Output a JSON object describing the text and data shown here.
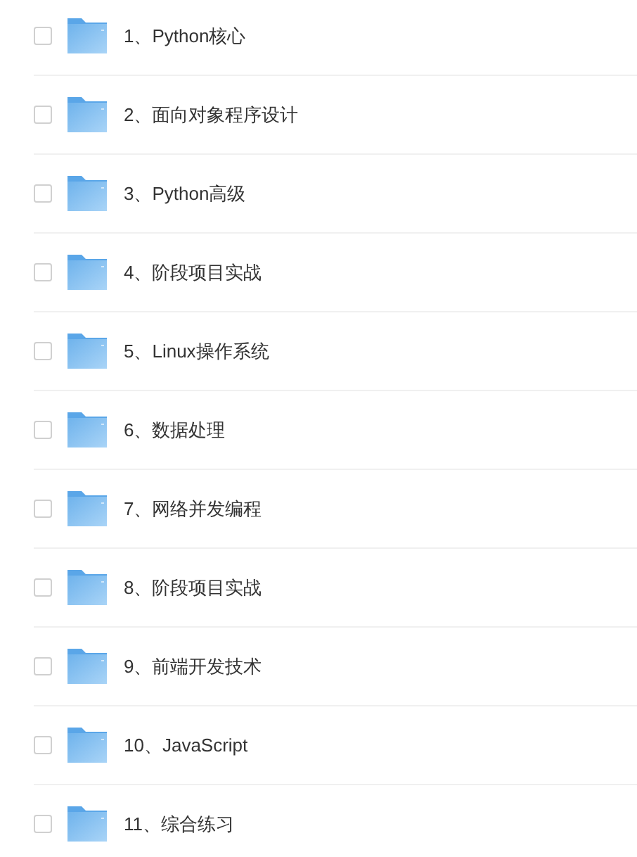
{
  "items": [
    {
      "name": "1、Python核心",
      "checked": false
    },
    {
      "name": "2、面向对象程序设计",
      "checked": false
    },
    {
      "name": "3、Python高级",
      "checked": false
    },
    {
      "name": "4、阶段项目实战",
      "checked": false
    },
    {
      "name": "5、Linux操作系统",
      "checked": false
    },
    {
      "name": "6、数据处理",
      "checked": false
    },
    {
      "name": "7、网络并发编程",
      "checked": false
    },
    {
      "name": "8、阶段项目实战",
      "checked": false
    },
    {
      "name": "9、前端开发技术",
      "checked": false
    },
    {
      "name": "10、JavaScript",
      "checked": false
    },
    {
      "name": "11、综合练习",
      "checked": false
    }
  ]
}
